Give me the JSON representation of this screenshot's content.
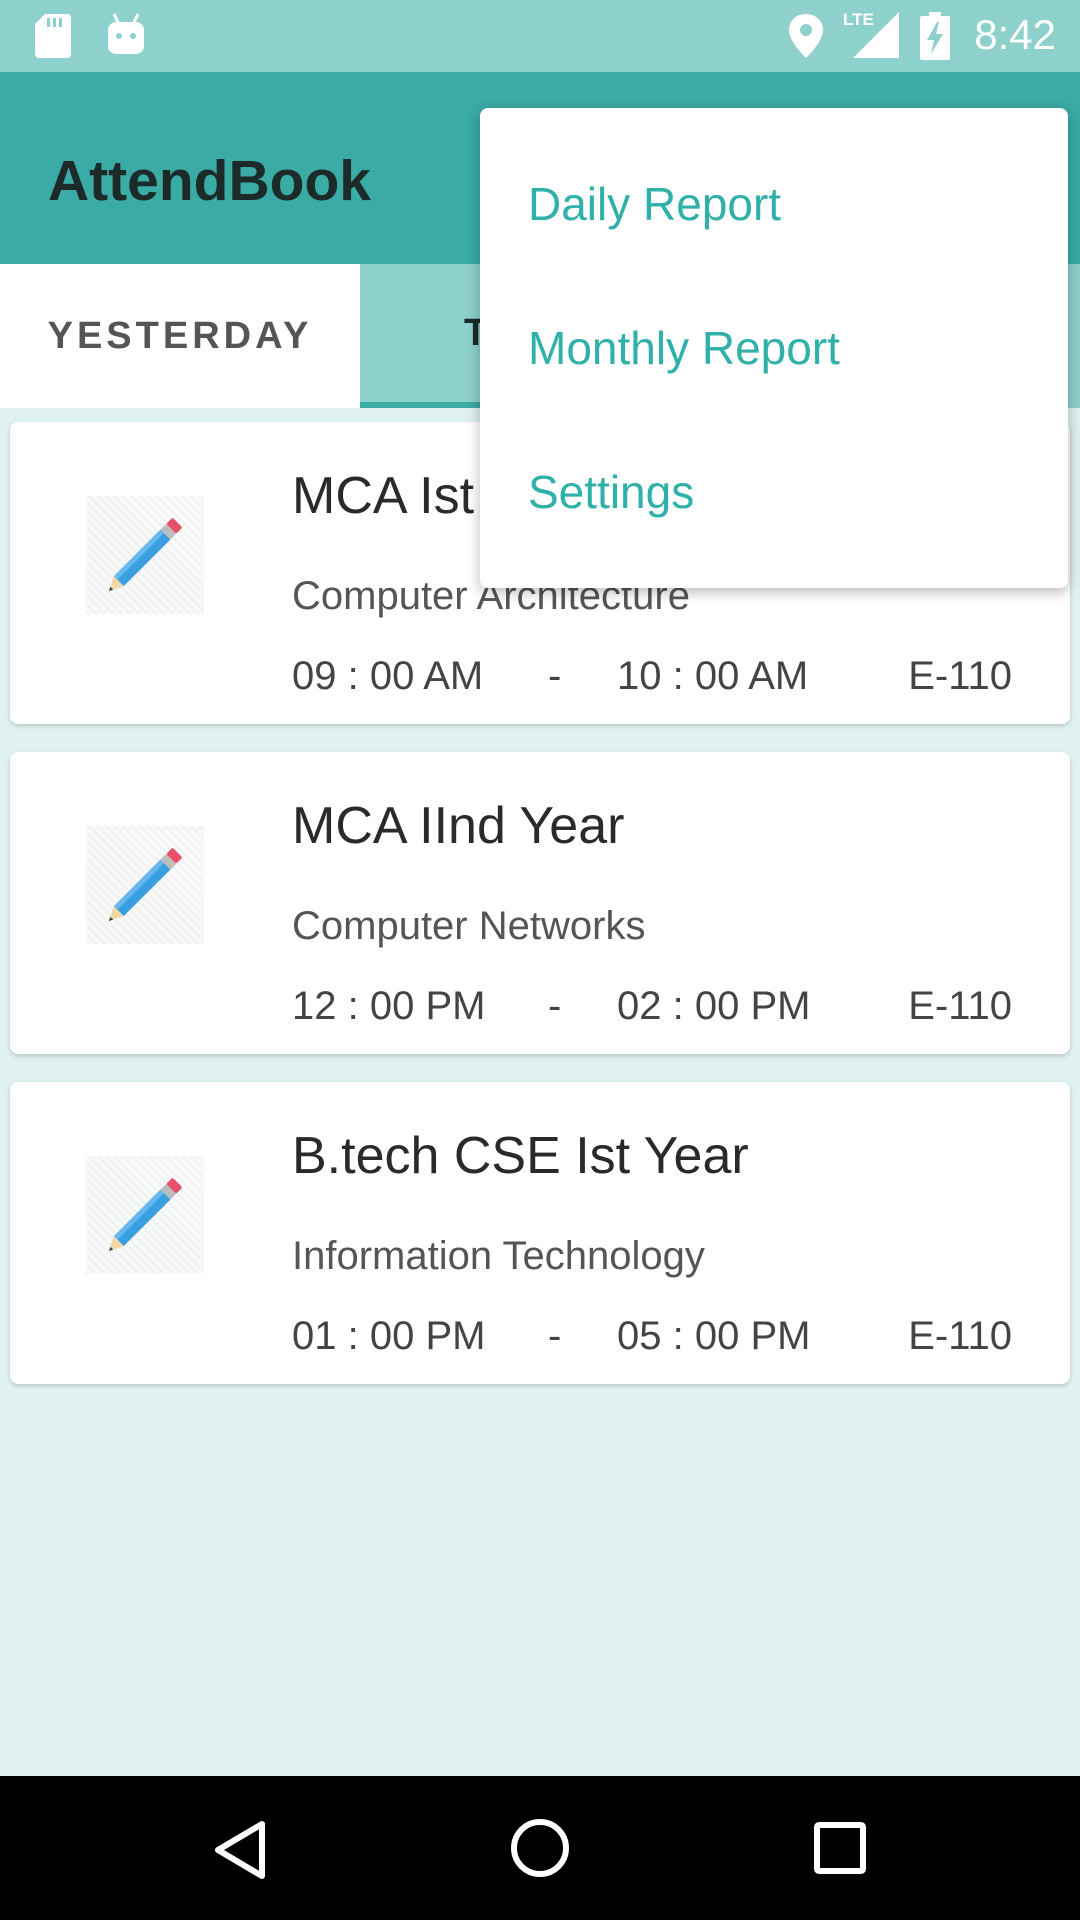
{
  "status_bar": {
    "time": "8:42",
    "network_label": "LTE",
    "icons": [
      "sd-card-icon",
      "android-icon",
      "location-icon",
      "lte-signal-icon",
      "battery-charging-icon"
    ]
  },
  "app_bar": {
    "title": "AttendBook"
  },
  "tabs": [
    {
      "label": "YESTERDAY",
      "selected": false
    },
    {
      "label": "T",
      "selected": true
    }
  ],
  "classes": [
    {
      "name": "MCA Ist",
      "subject": "Computer Architecture",
      "start": "09 : 00 AM",
      "separator": "-",
      "end": "10 : 00 AM",
      "room": "E-110",
      "icon": "pencil-icon"
    },
    {
      "name": "MCA IInd Year",
      "subject": "Computer Networks",
      "start": "12 : 00 PM",
      "separator": "-",
      "end": "02 : 00 PM",
      "room": "E-110",
      "icon": "pencil-icon"
    },
    {
      "name": "B.tech CSE Ist Year",
      "subject": "Information Technology",
      "start": "01 : 00 PM",
      "separator": "-",
      "end": "05 : 00 PM",
      "room": "E-110",
      "icon": "pencil-icon"
    }
  ],
  "overflow_menu": {
    "items": [
      {
        "label": "Daily Report"
      },
      {
        "label": "Monthly Report"
      },
      {
        "label": "Settings"
      }
    ]
  },
  "nav_bar": {
    "icons": [
      "back-icon",
      "home-icon",
      "recents-icon"
    ]
  },
  "colors": {
    "status_bar": "#8ed1cc",
    "app_bar": "#3aaba5",
    "background": "#dff1f0",
    "menu_text": "#2fb1a9"
  }
}
